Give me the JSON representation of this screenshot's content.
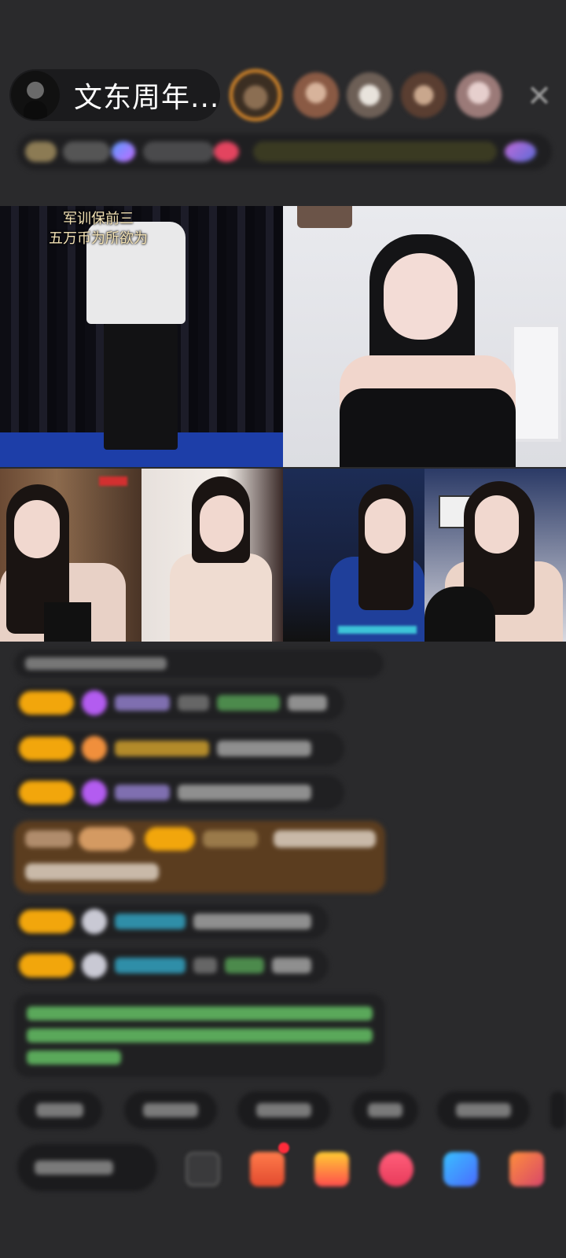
{
  "header": {
    "host_name": "文东周年...",
    "icons": {
      "avatar": "host-avatar",
      "close": "close-icon"
    }
  },
  "stream": {
    "caption": [
      "军训保前三",
      "五万币为所欲为"
    ]
  },
  "colors": {
    "background": "#2a2a2c",
    "level_badge": "#f2a60c",
    "vip_bg": "#5b3d1f",
    "accent_orange": "#e8912a",
    "caption_text": "#f3e2b5"
  }
}
